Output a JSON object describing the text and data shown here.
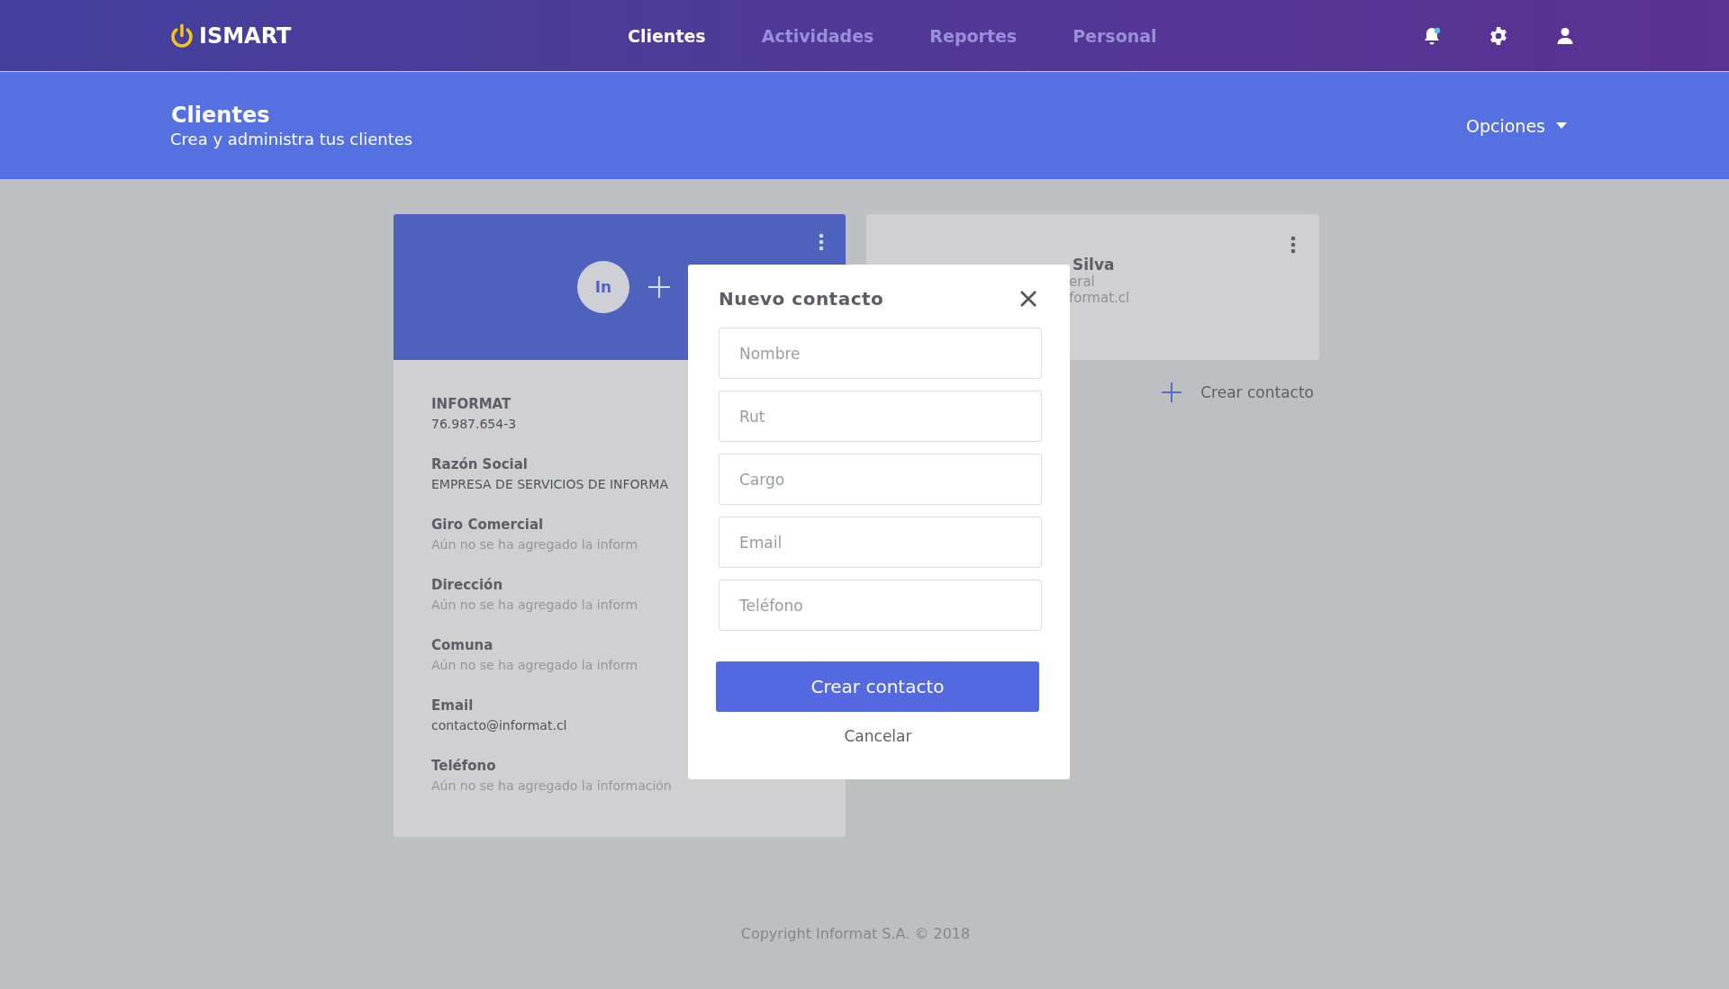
{
  "brand": {
    "name": "ISMART"
  },
  "nav": [
    {
      "label": "Clientes",
      "selected": true
    },
    {
      "label": "Actividades",
      "selected": false
    },
    {
      "label": "Reportes",
      "selected": false
    },
    {
      "label": "Personal",
      "selected": false
    }
  ],
  "header": {
    "title": "Clientes",
    "subtitle": "Crea y administra tus clientes",
    "options": "Opciones"
  },
  "client_card": {
    "avatar": "In",
    "fields": [
      {
        "label": "INFORMAT",
        "value": "76.987.654-3",
        "empty": false
      },
      {
        "label": "Razón Social",
        "value": "EMPRESA DE SERVICIOS DE INFORMA",
        "empty": false
      },
      {
        "label": "Giro Comercial",
        "value": "Aún no se ha agregado la inform",
        "empty": true
      },
      {
        "label": "Dirección",
        "value": "Aún no se ha agregado la inform",
        "empty": true
      },
      {
        "label": "Comuna",
        "value": "Aún no se ha agregado la inform",
        "empty": true
      },
      {
        "label": "Email",
        "value": "contacto@informat.cl",
        "empty": false
      },
      {
        "label": "Teléfono",
        "value": "Aún no se ha agregado la información",
        "empty": true
      }
    ]
  },
  "contact_card": {
    "name": "Silva",
    "lines": [
      "eral",
      "format.cl"
    ]
  },
  "create_contact_link": "Crear contacto",
  "modal": {
    "title": "Nuevo contacto",
    "fields": [
      {
        "placeholder": "Nombre"
      },
      {
        "placeholder": "Rut"
      },
      {
        "placeholder": "Cargo"
      },
      {
        "placeholder": "Email"
      },
      {
        "placeholder": "Teléfono"
      }
    ],
    "submit": "Crear contacto",
    "cancel": "Cancelar"
  },
  "footer": {
    "copyright": "Copyright Informat S.A. © 2018"
  }
}
